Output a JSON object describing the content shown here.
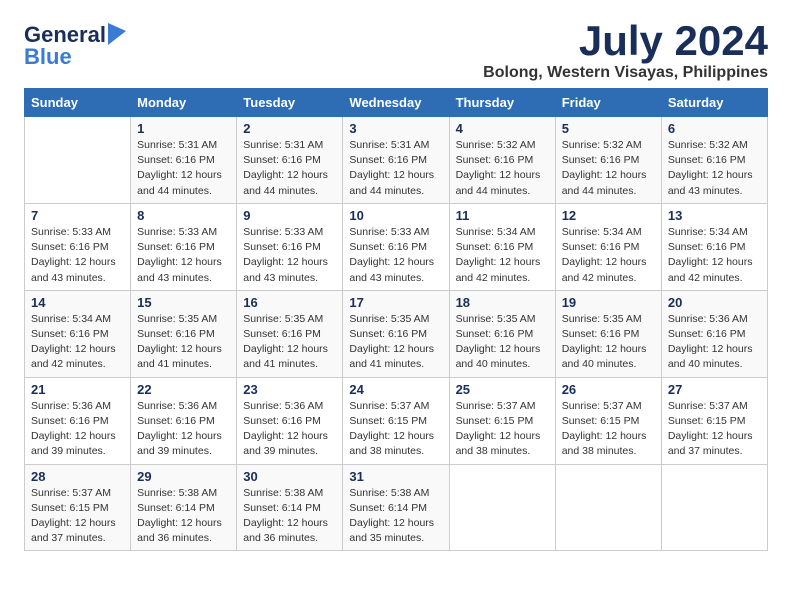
{
  "header": {
    "logo_general": "General",
    "logo_blue": "Blue",
    "month_title": "July 2024",
    "location": "Bolong, Western Visayas, Philippines"
  },
  "calendar": {
    "days_of_week": [
      "Sunday",
      "Monday",
      "Tuesday",
      "Wednesday",
      "Thursday",
      "Friday",
      "Saturday"
    ],
    "weeks": [
      [
        {
          "day": "",
          "sunrise": "",
          "sunset": "",
          "daylight": ""
        },
        {
          "day": "1",
          "sunrise": "Sunrise: 5:31 AM",
          "sunset": "Sunset: 6:16 PM",
          "daylight": "Daylight: 12 hours and 44 minutes."
        },
        {
          "day": "2",
          "sunrise": "Sunrise: 5:31 AM",
          "sunset": "Sunset: 6:16 PM",
          "daylight": "Daylight: 12 hours and 44 minutes."
        },
        {
          "day": "3",
          "sunrise": "Sunrise: 5:31 AM",
          "sunset": "Sunset: 6:16 PM",
          "daylight": "Daylight: 12 hours and 44 minutes."
        },
        {
          "day": "4",
          "sunrise": "Sunrise: 5:32 AM",
          "sunset": "Sunset: 6:16 PM",
          "daylight": "Daylight: 12 hours and 44 minutes."
        },
        {
          "day": "5",
          "sunrise": "Sunrise: 5:32 AM",
          "sunset": "Sunset: 6:16 PM",
          "daylight": "Daylight: 12 hours and 44 minutes."
        },
        {
          "day": "6",
          "sunrise": "Sunrise: 5:32 AM",
          "sunset": "Sunset: 6:16 PM",
          "daylight": "Daylight: 12 hours and 43 minutes."
        }
      ],
      [
        {
          "day": "7",
          "sunrise": "Sunrise: 5:33 AM",
          "sunset": "Sunset: 6:16 PM",
          "daylight": "Daylight: 12 hours and 43 minutes."
        },
        {
          "day": "8",
          "sunrise": "Sunrise: 5:33 AM",
          "sunset": "Sunset: 6:16 PM",
          "daylight": "Daylight: 12 hours and 43 minutes."
        },
        {
          "day": "9",
          "sunrise": "Sunrise: 5:33 AM",
          "sunset": "Sunset: 6:16 PM",
          "daylight": "Daylight: 12 hours and 43 minutes."
        },
        {
          "day": "10",
          "sunrise": "Sunrise: 5:33 AM",
          "sunset": "Sunset: 6:16 PM",
          "daylight": "Daylight: 12 hours and 43 minutes."
        },
        {
          "day": "11",
          "sunrise": "Sunrise: 5:34 AM",
          "sunset": "Sunset: 6:16 PM",
          "daylight": "Daylight: 12 hours and 42 minutes."
        },
        {
          "day": "12",
          "sunrise": "Sunrise: 5:34 AM",
          "sunset": "Sunset: 6:16 PM",
          "daylight": "Daylight: 12 hours and 42 minutes."
        },
        {
          "day": "13",
          "sunrise": "Sunrise: 5:34 AM",
          "sunset": "Sunset: 6:16 PM",
          "daylight": "Daylight: 12 hours and 42 minutes."
        }
      ],
      [
        {
          "day": "14",
          "sunrise": "Sunrise: 5:34 AM",
          "sunset": "Sunset: 6:16 PM",
          "daylight": "Daylight: 12 hours and 42 minutes."
        },
        {
          "day": "15",
          "sunrise": "Sunrise: 5:35 AM",
          "sunset": "Sunset: 6:16 PM",
          "daylight": "Daylight: 12 hours and 41 minutes."
        },
        {
          "day": "16",
          "sunrise": "Sunrise: 5:35 AM",
          "sunset": "Sunset: 6:16 PM",
          "daylight": "Daylight: 12 hours and 41 minutes."
        },
        {
          "day": "17",
          "sunrise": "Sunrise: 5:35 AM",
          "sunset": "Sunset: 6:16 PM",
          "daylight": "Daylight: 12 hours and 41 minutes."
        },
        {
          "day": "18",
          "sunrise": "Sunrise: 5:35 AM",
          "sunset": "Sunset: 6:16 PM",
          "daylight": "Daylight: 12 hours and 40 minutes."
        },
        {
          "day": "19",
          "sunrise": "Sunrise: 5:35 AM",
          "sunset": "Sunset: 6:16 PM",
          "daylight": "Daylight: 12 hours and 40 minutes."
        },
        {
          "day": "20",
          "sunrise": "Sunrise: 5:36 AM",
          "sunset": "Sunset: 6:16 PM",
          "daylight": "Daylight: 12 hours and 40 minutes."
        }
      ],
      [
        {
          "day": "21",
          "sunrise": "Sunrise: 5:36 AM",
          "sunset": "Sunset: 6:16 PM",
          "daylight": "Daylight: 12 hours and 39 minutes."
        },
        {
          "day": "22",
          "sunrise": "Sunrise: 5:36 AM",
          "sunset": "Sunset: 6:16 PM",
          "daylight": "Daylight: 12 hours and 39 minutes."
        },
        {
          "day": "23",
          "sunrise": "Sunrise: 5:36 AM",
          "sunset": "Sunset: 6:16 PM",
          "daylight": "Daylight: 12 hours and 39 minutes."
        },
        {
          "day": "24",
          "sunrise": "Sunrise: 5:37 AM",
          "sunset": "Sunset: 6:15 PM",
          "daylight": "Daylight: 12 hours and 38 minutes."
        },
        {
          "day": "25",
          "sunrise": "Sunrise: 5:37 AM",
          "sunset": "Sunset: 6:15 PM",
          "daylight": "Daylight: 12 hours and 38 minutes."
        },
        {
          "day": "26",
          "sunrise": "Sunrise: 5:37 AM",
          "sunset": "Sunset: 6:15 PM",
          "daylight": "Daylight: 12 hours and 38 minutes."
        },
        {
          "day": "27",
          "sunrise": "Sunrise: 5:37 AM",
          "sunset": "Sunset: 6:15 PM",
          "daylight": "Daylight: 12 hours and 37 minutes."
        }
      ],
      [
        {
          "day": "28",
          "sunrise": "Sunrise: 5:37 AM",
          "sunset": "Sunset: 6:15 PM",
          "daylight": "Daylight: 12 hours and 37 minutes."
        },
        {
          "day": "29",
          "sunrise": "Sunrise: 5:38 AM",
          "sunset": "Sunset: 6:14 PM",
          "daylight": "Daylight: 12 hours and 36 minutes."
        },
        {
          "day": "30",
          "sunrise": "Sunrise: 5:38 AM",
          "sunset": "Sunset: 6:14 PM",
          "daylight": "Daylight: 12 hours and 36 minutes."
        },
        {
          "day": "31",
          "sunrise": "Sunrise: 5:38 AM",
          "sunset": "Sunset: 6:14 PM",
          "daylight": "Daylight: 12 hours and 35 minutes."
        },
        {
          "day": "",
          "sunrise": "",
          "sunset": "",
          "daylight": ""
        },
        {
          "day": "",
          "sunrise": "",
          "sunset": "",
          "daylight": ""
        },
        {
          "day": "",
          "sunrise": "",
          "sunset": "",
          "daylight": ""
        }
      ]
    ]
  }
}
